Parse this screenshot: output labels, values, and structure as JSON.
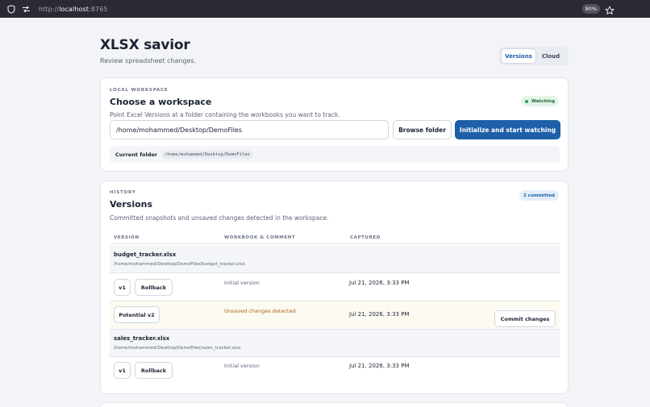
{
  "browser": {
    "url_scheme": "http://",
    "url_host": "localhost",
    "url_port": ":8765",
    "zoom": "90%"
  },
  "header": {
    "title": "XLSX savior",
    "subtitle": "Review spreadsheet changes.",
    "tabs": [
      {
        "label": "Versions",
        "active": true
      },
      {
        "label": "Cloud",
        "active": false
      }
    ]
  },
  "workspace": {
    "eyebrow": "LOCAL WORKSPACE",
    "title": "Choose a workspace",
    "description": "Point Excel Versions at a folder containing the workbooks you want to track.",
    "status_badge": "Watching",
    "path_value": "/home/mohammed/Desktop/DemoFiles",
    "browse_label": "Browse folder",
    "init_label": "Initialize and start watching",
    "current_folder_label": "Current folder",
    "current_folder_value": "/home/mohammed/Desktop/DemoFiles"
  },
  "history": {
    "eyebrow": "HISTORY",
    "title": "Versions",
    "description": "Committed snapshots and unsaved changes detected in the workspace.",
    "count_badge": "2 committed",
    "columns": [
      "VERSION",
      "WORKBOOK & COMMENT",
      "CAPTURED"
    ],
    "files": [
      {
        "name": "budget_tracker.xlsx",
        "path": "/home/mohammed/Desktop/DemoFiles/budget_tracker.xlsx",
        "version": "v1",
        "rollback_label": "Rollback",
        "comment": "Initial version",
        "captured": "Jul 21, 2026, 3:33 PM",
        "pending": {
          "label": "Potential v2",
          "comment": "Unsaved changes detected",
          "captured": "Jul 21, 2026, 3:33 PM",
          "commit_label": "Commit changes"
        }
      },
      {
        "name": "sales_tracker.xlsx",
        "path": "/home/mohammed/Desktop/DemoFiles/sales_tracker.xlsx",
        "version": "v1",
        "rollback_label": "Rollback",
        "comment": "Initial version",
        "captured": "Jul 21, 2026, 3:33 PM"
      }
    ]
  },
  "colors": {
    "accent": "#1e5fa8",
    "watching_badge": "#e3f4e8",
    "pending_row": "#fdfaf1",
    "warning_text": "#a8671a"
  },
  "icons": [
    "shield-icon",
    "permissions-icon",
    "star-icon",
    "status-dot-icon"
  ]
}
